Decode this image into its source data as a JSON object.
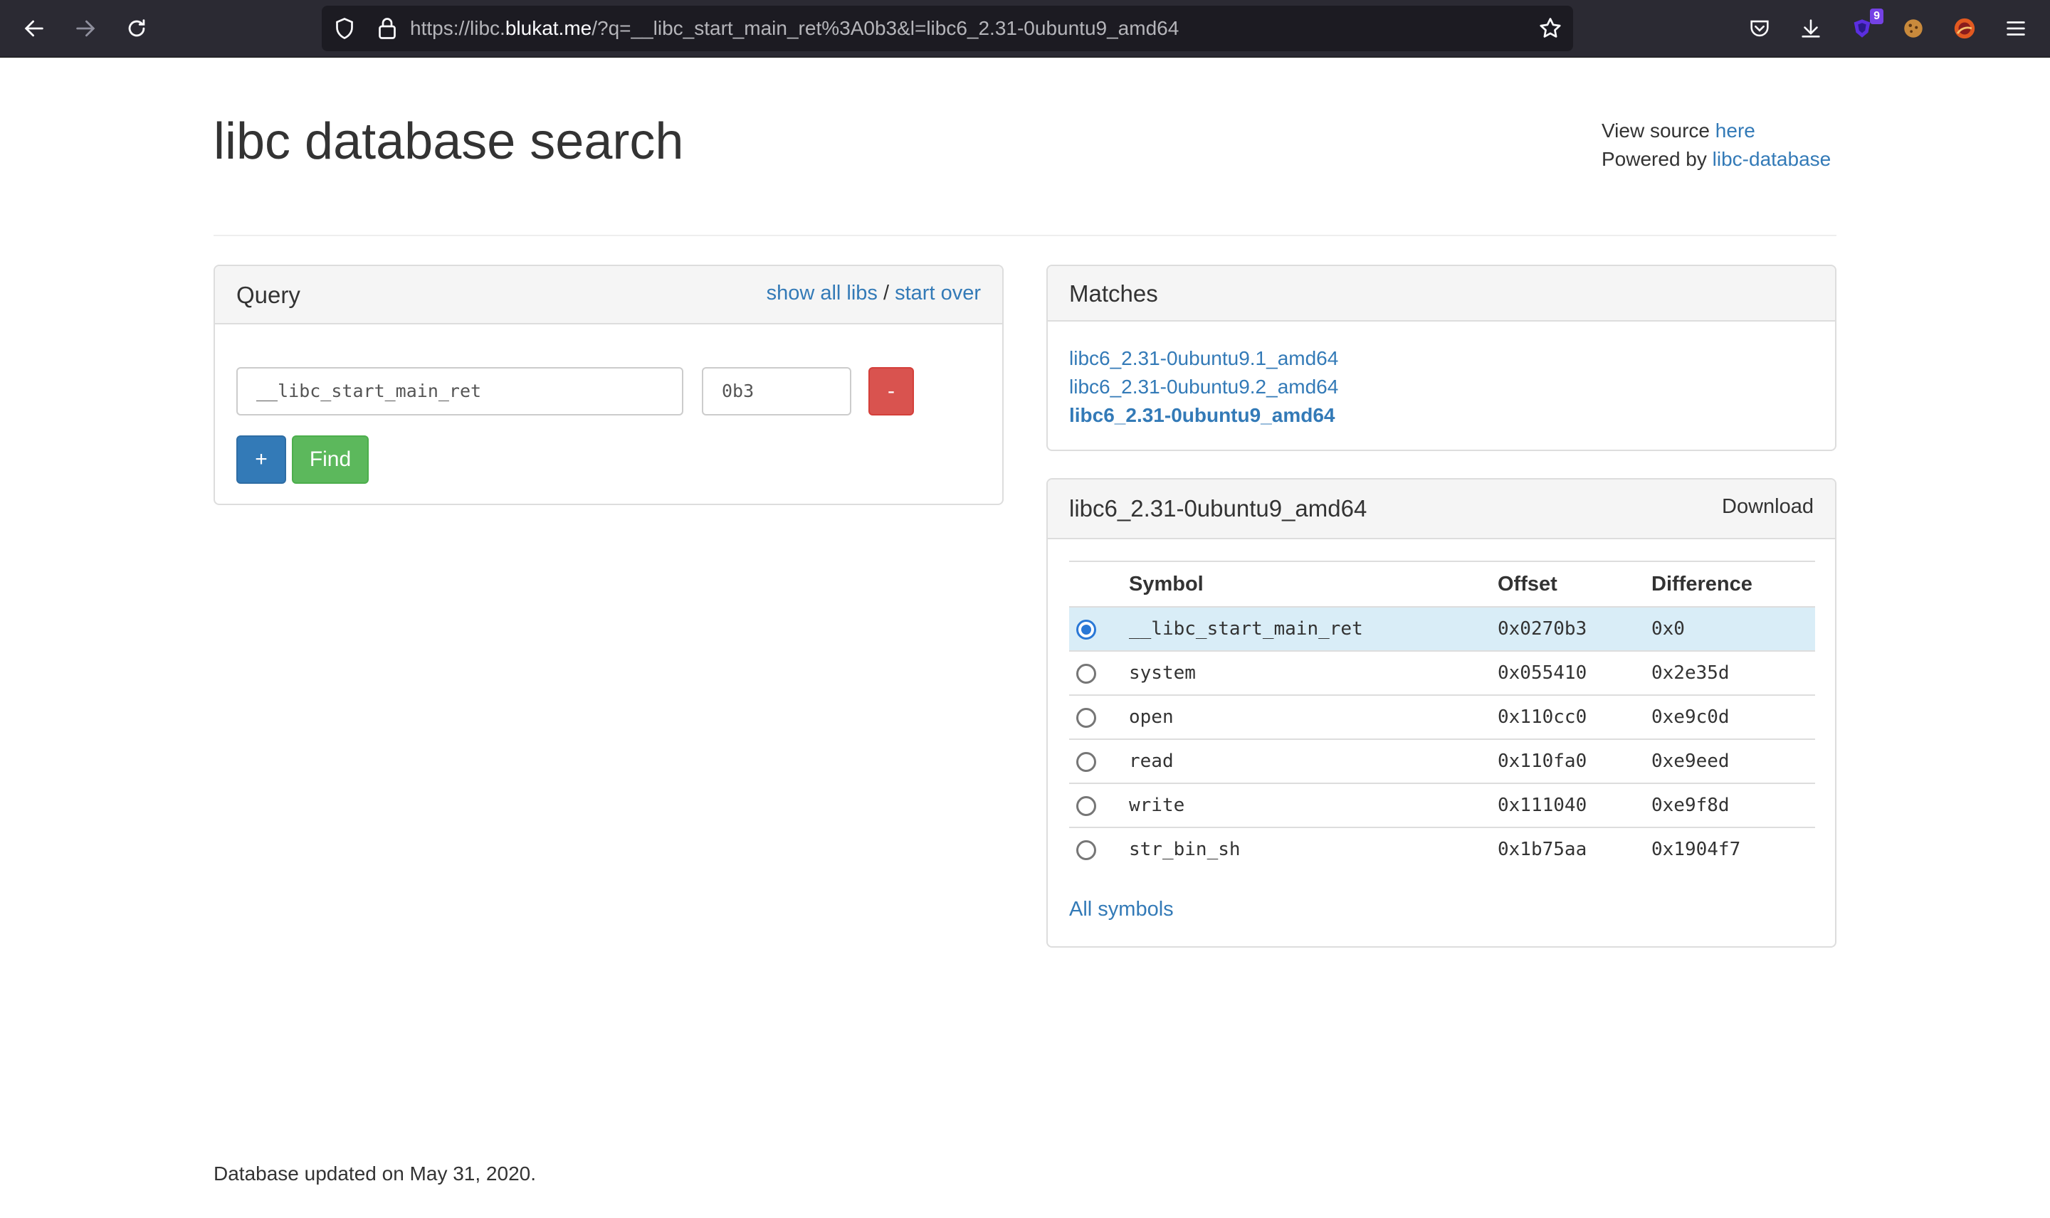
{
  "browser": {
    "url_prefix": "https://libc.",
    "url_domain": "blukat.me",
    "url_rest": "/?q=__libc_start_main_ret%3A0b3&l=libc6_2.31-0ubuntu9_amd64",
    "extension_badge": "9",
    "icons": [
      "back-icon",
      "forward-icon",
      "reload-icon",
      "shield-icon",
      "lock-icon",
      "bookmark-star-icon",
      "pocket-icon",
      "download-icon",
      "extension-icon",
      "cookie-icon",
      "avatar-icon",
      "menu-icon"
    ]
  },
  "header": {
    "title": "libc database search",
    "view_source_text": "View source",
    "view_source_link": "here",
    "powered_by_text": "Powered by",
    "powered_by_link": "libc-database"
  },
  "query": {
    "title": "Query",
    "show_all_libs": "show all libs",
    "separator": "/",
    "start_over": "start over",
    "symbol_value": "__libc_start_main_ret",
    "address_value": "0b3",
    "remove_label": "-",
    "add_label": "+",
    "find_label": "Find"
  },
  "matches": {
    "title": "Matches",
    "items": [
      {
        "label": "libc6_2.31-0ubuntu9.1_amd64"
      },
      {
        "label": "libc6_2.31-0ubuntu9.2_amd64"
      },
      {
        "label": "libc6_2.31-0ubuntu9_amd64"
      }
    ]
  },
  "library": {
    "title": "libc6_2.31-0ubuntu9_amd64",
    "download": "Download",
    "columns": {
      "symbol": "Symbol",
      "offset": "Offset",
      "difference": "Difference"
    },
    "rows": [
      {
        "symbol": "__libc_start_main_ret",
        "offset": "0x0270b3",
        "difference": "0x0",
        "selected": true
      },
      {
        "symbol": "system",
        "offset": "0x055410",
        "difference": "0x2e35d",
        "selected": false
      },
      {
        "symbol": "open",
        "offset": "0x110cc0",
        "difference": "0xe9c0d",
        "selected": false
      },
      {
        "symbol": "read",
        "offset": "0x110fa0",
        "difference": "0xe9eed",
        "selected": false
      },
      {
        "symbol": "write",
        "offset": "0x111040",
        "difference": "0xe9f8d",
        "selected": false
      },
      {
        "symbol": "str_bin_sh",
        "offset": "0x1b75aa",
        "difference": "0x1904f7",
        "selected": false
      }
    ],
    "all_symbols": "All symbols"
  },
  "footer": {
    "text": "Database updated on May 31, 2020."
  },
  "colors": {
    "link": "#337ab7",
    "danger": "#d9534f",
    "primary": "#337ab7",
    "success": "#5cb85c",
    "selected_row": "#d9edf7",
    "toolbar": "#2b2a33"
  }
}
